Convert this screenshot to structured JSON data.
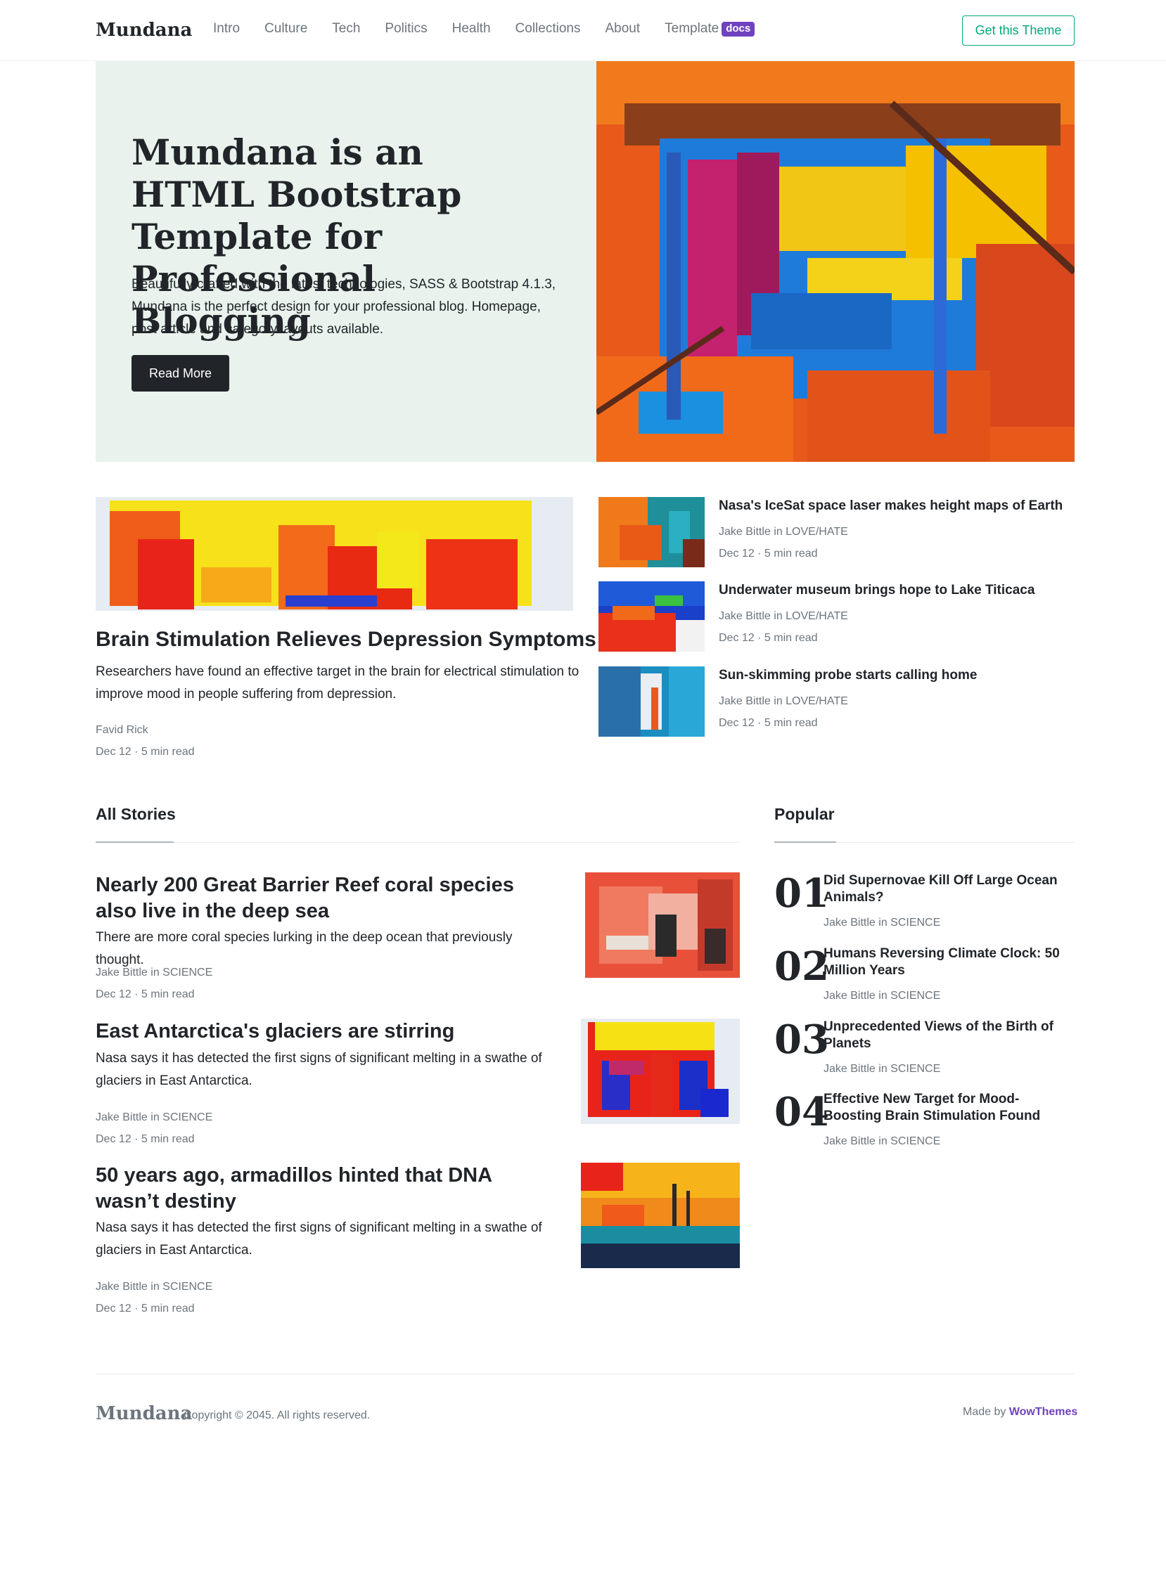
{
  "nav": {
    "brand": "Mundana",
    "items": [
      "Intro",
      "Culture",
      "Tech",
      "Politics",
      "Health",
      "Collections",
      "About"
    ],
    "template_label": "Template",
    "template_badge": "docs",
    "cta": "Get this Theme"
  },
  "hero": {
    "title": "Mundana is an HTML Bootstrap Template for Professional Blogging",
    "text": "Beautifully crafted with the latest technologies, SASS & Bootstrap 4.1.3, Mundana is the perfect design for your professional blog. Homepage, post article and category layouts available.",
    "button": "Read More"
  },
  "featured": {
    "title": "Brain Stimulation Relieves Depression Symptoms",
    "text": "Researchers have found an effective target in the brain for electrical stimulation to improve mood in people suffering from depression.",
    "author": "Favid Rick",
    "date": "Dec 12 · 5 min read"
  },
  "side_posts": [
    {
      "title": "Nasa's IceSat space laser makes height maps of Earth",
      "byline": "Jake Bittle in LOVE/HATE",
      "date": "Dec 12 · 5 min read"
    },
    {
      "title": "Underwater museum brings hope to Lake Titicaca",
      "byline": "Jake Bittle in LOVE/HATE",
      "date": "Dec 12 · 5 min read"
    },
    {
      "title": "Sun-skimming probe starts calling home",
      "byline": "Jake Bittle in LOVE/HATE",
      "date": "Dec 12 · 5 min read"
    }
  ],
  "all_stories": {
    "heading": "All Stories",
    "items": [
      {
        "title": "Nearly 200 Great Barrier Reef coral species also live in the deep sea",
        "text": "There are more coral species lurking in the deep ocean that previously thought.",
        "byline": "Jake Bittle in SCIENCE",
        "date": "Dec 12 · 5 min read"
      },
      {
        "title": "East Antarctica's glaciers are stirring",
        "text": "Nasa says it has detected the first signs of significant melting in a swathe of glaciers in East Antarctica.",
        "byline": "Jake Bittle in SCIENCE",
        "date": "Dec 12 · 5 min read"
      },
      {
        "title": "50 years ago, armadillos hinted that DNA wasn’t destiny",
        "text": "Nasa says it has detected the first signs of significant melting in a swathe of glaciers in East Antarctica.",
        "byline": "Jake Bittle in SCIENCE",
        "date": "Dec 12 · 5 min read"
      }
    ]
  },
  "popular": {
    "heading": "Popular",
    "items": [
      {
        "num": "01",
        "title": "Did Supernovae Kill Off Large Ocean Animals?",
        "byline": "Jake Bittle in SCIENCE"
      },
      {
        "num": "02",
        "title": "Humans Reversing Climate Clock: 50 Million Years",
        "byline": "Jake Bittle in SCIENCE"
      },
      {
        "num": "03",
        "title": "Unprecedented Views of the Birth of Planets",
        "byline": "Jake Bittle in SCIENCE"
      },
      {
        "num": "04",
        "title": "Effective New Target for Mood-Boosting Brain Stimulation Found",
        "byline": "Jake Bittle in SCIENCE"
      }
    ]
  },
  "footer": {
    "brand": "Mundana",
    "copyright": "Copyright © 2045. All rights reserved.",
    "made_by_prefix": "Made by ",
    "made_by_name": "WowThemes"
  },
  "colors": {
    "accent_green": "#03a87c",
    "badge_purple": "#6f42c1",
    "hero_bg": "#e9f2ec",
    "dark": "#212529"
  }
}
